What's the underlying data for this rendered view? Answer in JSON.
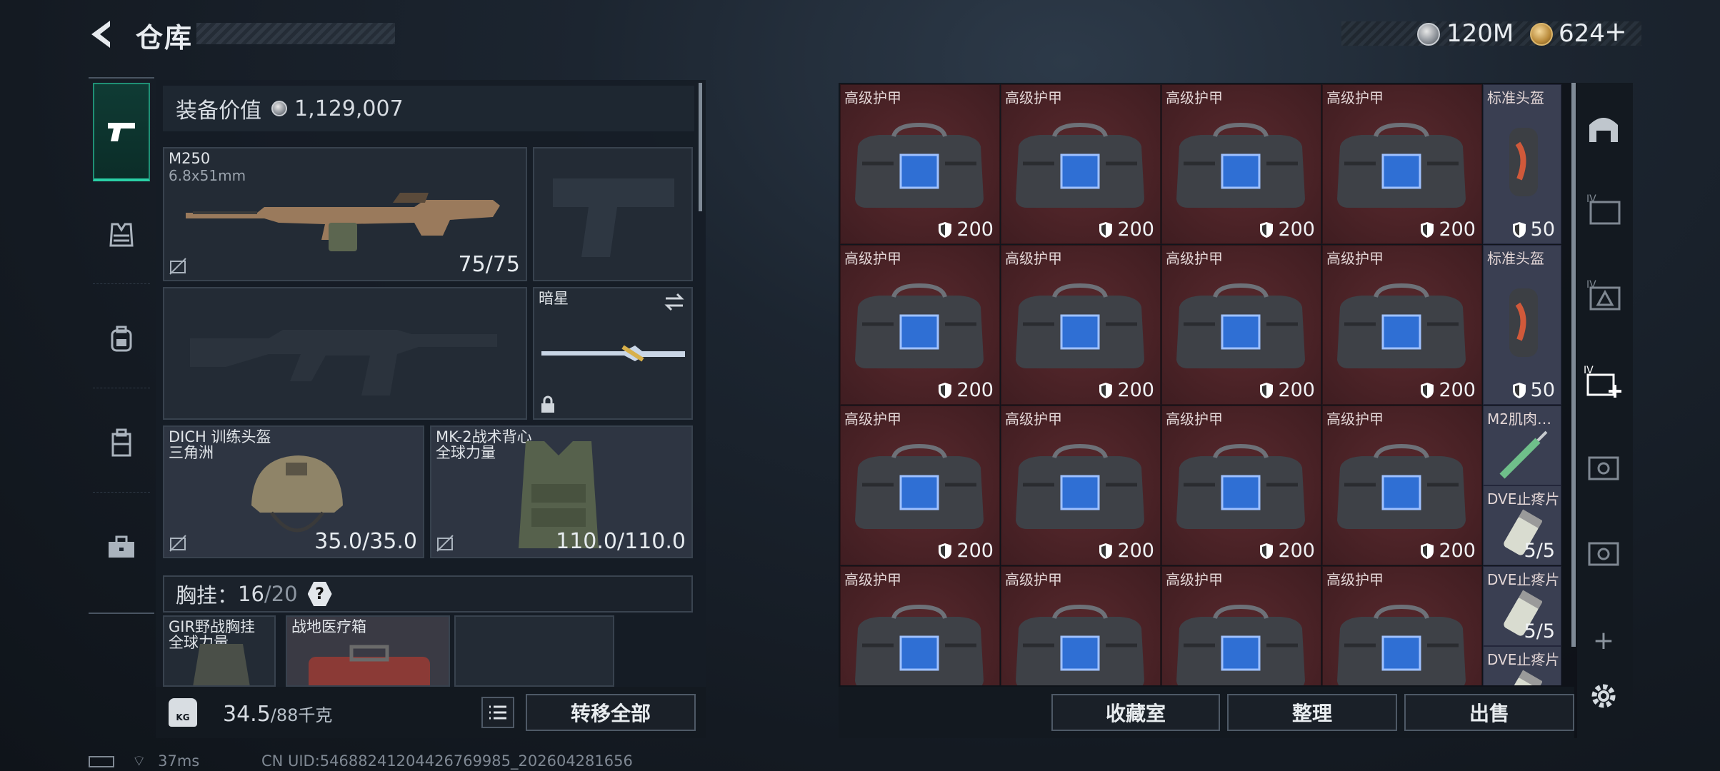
{
  "header": {
    "title": "仓库",
    "currency_silver": "120M",
    "currency_gold": "624"
  },
  "tabs": [
    {
      "icon": "pistol-icon",
      "active": true
    },
    {
      "icon": "vest-icon"
    },
    {
      "icon": "backpack-icon"
    },
    {
      "icon": "rig-icon"
    },
    {
      "icon": "briefcase-icon"
    }
  ],
  "equipment": {
    "value_label": "装备价值",
    "value": "1,129,007"
  },
  "slots": {
    "primary": {
      "name": "M250",
      "ammo": "6.8x51mm",
      "value": "75/75"
    },
    "melee": {
      "name": "暗星"
    },
    "helmet": {
      "name": "DICH 训练头盔",
      "sub": "三角洲",
      "value": "35.0/35.0"
    },
    "armor": {
      "name": "MK-2战术背心",
      "sub": "全球力量",
      "value": "110.0/110.0"
    }
  },
  "chest": {
    "label": "胸挂：",
    "count": "16",
    "capacity": "/20",
    "help": "?"
  },
  "chest_items": [
    {
      "name": "GIR野战胸挂",
      "sub": "全球力量"
    },
    {
      "name": "战地医疗箱"
    }
  ],
  "weight": {
    "value": "34.5",
    "max": "/88千克",
    "kg_icon": "KG"
  },
  "buttons": {
    "transfer_all": "转移全部",
    "collection": "收藏室",
    "sort": "整理",
    "sell": "出售"
  },
  "grid": {
    "bag_label": "高级护甲",
    "bag_value": "200",
    "side": [
      {
        "label": "标准头盔",
        "value": "50"
      },
      {
        "label": "标准头盔",
        "value": "50"
      },
      {
        "label": "M2肌肉…",
        "value": ""
      },
      {
        "label": "DVE止疼片",
        "value": "5/5"
      },
      {
        "label": "DVE止疼片",
        "value": "5/5"
      },
      {
        "label": "DVE止疼片",
        "value": ""
      }
    ]
  },
  "status": {
    "ping": "37ms",
    "uid": "CN UID:5468824120442676998​5_202604281656"
  }
}
